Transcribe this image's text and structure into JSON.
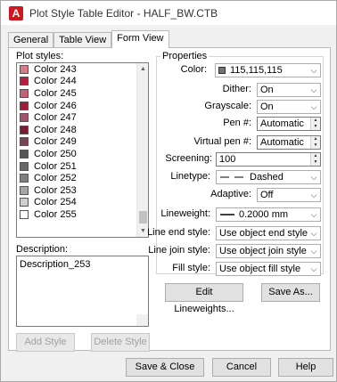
{
  "window": {
    "title": "Plot Style Table Editor - HALF_BW.CTB",
    "app_icon_letter": "A"
  },
  "tabs": [
    {
      "label": "General",
      "active": false
    },
    {
      "label": "Table View",
      "active": false
    },
    {
      "label": "Form View",
      "active": true
    }
  ],
  "plot_styles": {
    "label": "Plot styles:",
    "items": [
      {
        "label": "Color 243",
        "color": "#d77b8b"
      },
      {
        "label": "Color 244",
        "color": "#bb1d40"
      },
      {
        "label": "Color 245",
        "color": "#c26479"
      },
      {
        "label": "Color 246",
        "color": "#9d1f3d"
      },
      {
        "label": "Color 247",
        "color": "#a3536a"
      },
      {
        "label": "Color 248",
        "color": "#7e1a32"
      },
      {
        "label": "Color 249",
        "color": "#7a4255"
      },
      {
        "label": "Color 250",
        "color": "#555555"
      },
      {
        "label": "Color 251",
        "color": "#696969"
      },
      {
        "label": "Color 252",
        "color": "#808080"
      },
      {
        "label": "Color 253",
        "color": "#a6a6a6"
      },
      {
        "label": "Color 254",
        "color": "#cfcfcf"
      },
      {
        "label": "Color 255",
        "color": "#ffffff"
      }
    ]
  },
  "description": {
    "label": "Description:",
    "value": "Description_253"
  },
  "buttons": {
    "add_style": "Add Style",
    "delete_style": "Delete Style",
    "edit_lineweights": "Edit Lineweights...",
    "save_as": "Save As...",
    "save_close": "Save & Close",
    "cancel": "Cancel",
    "help": "Help"
  },
  "properties": {
    "legend": "Properties",
    "color": {
      "label": "Color:",
      "value": "115,115,115",
      "swatch": "#737373"
    },
    "dither": {
      "label": "Dither:",
      "value": "On"
    },
    "grayscale": {
      "label": "Grayscale:",
      "value": "On"
    },
    "pen": {
      "label": "Pen #:",
      "value": "Automatic"
    },
    "virtual_pen": {
      "label": "Virtual pen #:",
      "value": "Automatic"
    },
    "screening": {
      "label": "Screening:",
      "value": "100"
    },
    "linetype": {
      "label": "Linetype:",
      "value": "Dashed"
    },
    "adaptive": {
      "label": "Adaptive:",
      "value": "Off"
    },
    "lineweight": {
      "label": "Lineweight:",
      "value": "0.2000 mm"
    },
    "line_end_style": {
      "label": "Line end style:",
      "value": "Use object end style"
    },
    "line_join_style": {
      "label": "Line join style:",
      "value": "Use object join style"
    },
    "fill_style": {
      "label": "Fill style:",
      "value": "Use object fill style"
    }
  }
}
